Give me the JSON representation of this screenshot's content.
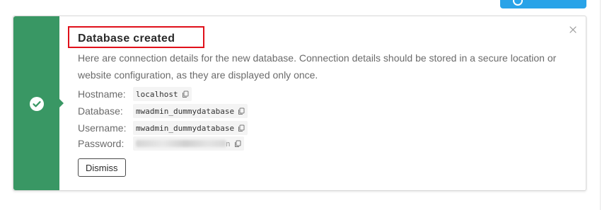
{
  "notice": {
    "title": "Database created",
    "description": "Here are connection details for the new database. Connection details should be stored in a secure location or website configuration, as they are displayed only once.",
    "details": [
      {
        "label": "Hostname:",
        "value": "localhost"
      },
      {
        "label": "Database:",
        "value": "mwadmin_dummydatabase"
      },
      {
        "label": "Username:",
        "value": "mwadmin_dummydatabase"
      },
      {
        "label": "Password:",
        "value": "n"
      }
    ],
    "dismiss_label": "Dismiss",
    "close_icon": "close-icon",
    "status_icon": "check-circle-icon",
    "copy_icon": "copy-icon",
    "accent_color": "#399764",
    "highlight_color": "#e0101a"
  },
  "top_button": {
    "icon": "circle-icon",
    "color": "#29a3e8"
  }
}
